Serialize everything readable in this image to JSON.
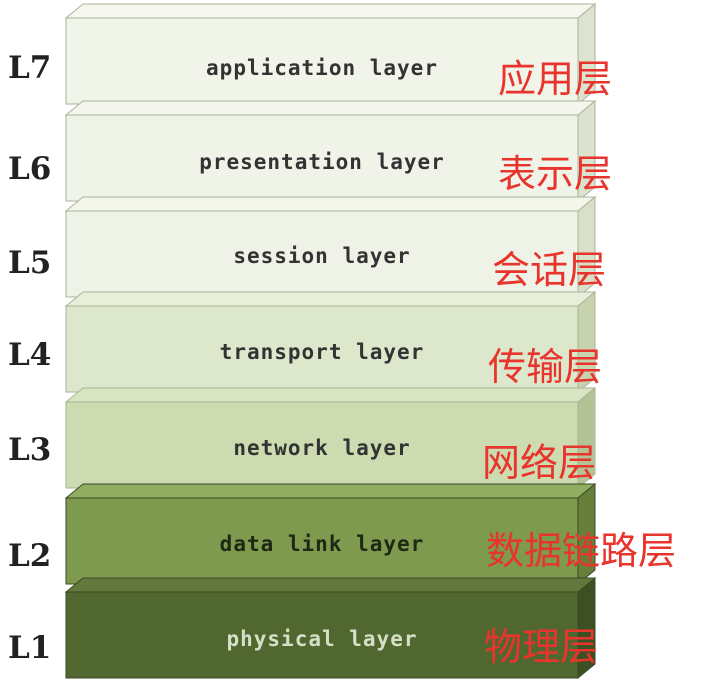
{
  "layers": [
    {
      "level": "L7",
      "name": "application layer",
      "name_zh": "应用层",
      "face": "#f1f4e9",
      "top": "#f6f8f0",
      "side": "#dde3cf",
      "text_color": "#333333"
    },
    {
      "level": "L6",
      "name": "presentation layer",
      "name_zh": "表示层",
      "face": "#f0f3e8",
      "top": "#f5f7ef",
      "side": "#dbe2cd",
      "text_color": "#333333"
    },
    {
      "level": "L5",
      "name": "session layer",
      "name_zh": "会话层",
      "face": "#eff2e6",
      "top": "#f4f6ec",
      "side": "#d9e0ca",
      "text_color": "#333333"
    },
    {
      "level": "L4",
      "name": "transport layer",
      "name_zh": "传输层",
      "face": "#dde7cb",
      "top": "#e7eed9",
      "side": "#c6d3ae",
      "text_color": "#333333"
    },
    {
      "level": "L3",
      "name": "network layer",
      "name_zh": "网络层",
      "face": "#ccdbb0",
      "top": "#d8e4c2",
      "side": "#b2c496",
      "text_color": "#333333"
    },
    {
      "level": "L2",
      "name": "data link layer",
      "name_zh": "数据链路层",
      "face": "#7d9a4e",
      "top": "#91ad62",
      "side": "#66803c",
      "text_color": "#1e2814"
    },
    {
      "level": "L1",
      "name": "physical layer",
      "name_zh": "物理层",
      "face": "#50682f",
      "top": "#62793d",
      "side": "#3d5024",
      "text_color": "#d6dec8"
    }
  ]
}
